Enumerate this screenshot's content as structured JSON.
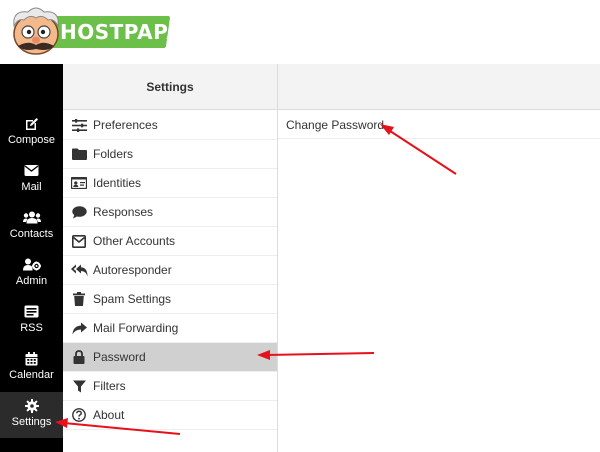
{
  "brand": {
    "logo_text": "HOSTPAPA",
    "banner_color": "#6cc04a"
  },
  "nav": {
    "items": [
      {
        "label": "Compose",
        "icon": "compose-icon"
      },
      {
        "label": "Mail",
        "icon": "mail-icon"
      },
      {
        "label": "Contacts",
        "icon": "contacts-icon"
      },
      {
        "label": "Admin",
        "icon": "admin-icon"
      },
      {
        "label": "RSS",
        "icon": "rss-icon"
      },
      {
        "label": "Calendar",
        "icon": "calendar-icon"
      },
      {
        "label": "Settings",
        "icon": "gear-icon",
        "selected": true
      }
    ]
  },
  "settings": {
    "title": "Settings",
    "items": [
      {
        "label": "Preferences",
        "icon": "sliders-icon"
      },
      {
        "label": "Folders",
        "icon": "folder-icon"
      },
      {
        "label": "Identities",
        "icon": "id-card-icon"
      },
      {
        "label": "Responses",
        "icon": "speech-bubble-icon"
      },
      {
        "label": "Other Accounts",
        "icon": "envelope-icon"
      },
      {
        "label": "Autoresponder",
        "icon": "reply-all-icon"
      },
      {
        "label": "Spam Settings",
        "icon": "trash-icon"
      },
      {
        "label": "Mail Forwarding",
        "icon": "forward-icon"
      },
      {
        "label": "Password",
        "icon": "lock-icon",
        "selected": true
      },
      {
        "label": "Filters",
        "icon": "filter-icon"
      },
      {
        "label": "About",
        "icon": "question-icon"
      }
    ]
  },
  "content": {
    "items": [
      {
        "label": "Change Password"
      }
    ]
  },
  "annotation": {
    "arrow_color": "#e8101a"
  }
}
